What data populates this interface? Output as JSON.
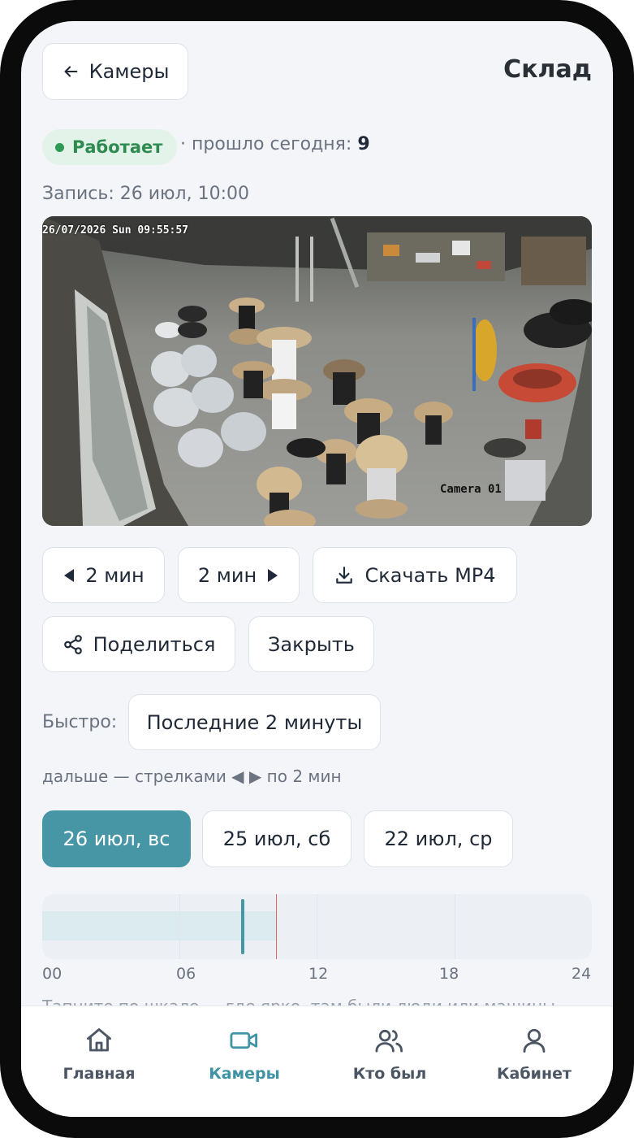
{
  "header": {
    "back_label": "Камеры",
    "title": "Склад"
  },
  "status": {
    "label": "Работает",
    "passed_label": "· прошло сегодня:",
    "passed_count": "9",
    "color": "#2e9a57"
  },
  "recording": {
    "label": "Запись: 26 июл, 10:00"
  },
  "video": {
    "timestamp": "26/07/2026 Sun 09:55:57",
    "camera_name": "Camera 01"
  },
  "controls": {
    "prev_label": "2 мин",
    "next_label": "2 мин",
    "download_label": "Скачать MP4",
    "share_label": "Поделиться",
    "close_label": "Закрыть"
  },
  "quick": {
    "label": "Быстро:",
    "option_label": "Последние 2 минуты",
    "hint": "дальше — стрелками ◀ ▶ по 2 мин"
  },
  "dates": [
    {
      "label": "26 июл, вс",
      "active": true
    },
    {
      "label": "25 июл, сб",
      "active": false
    },
    {
      "label": "22 июл, ср",
      "active": false
    }
  ],
  "timeline": {
    "ticks": [
      "00",
      "06",
      "12",
      "18",
      "24"
    ],
    "recorded_until_hour": 10.25,
    "cursor_hour": 8.75,
    "now_hour": 10.2,
    "accent": "#4796a6",
    "now_color": "#e06a5b"
  },
  "partial_text": "Тапните по шкале — где ярко, там были люди или машины",
  "tabbar": {
    "items": [
      {
        "label": "Главная",
        "icon": "home-icon",
        "active": false
      },
      {
        "label": "Камеры",
        "icon": "video-camera-icon",
        "active": true
      },
      {
        "label": "Кто был",
        "icon": "users-icon",
        "active": false
      },
      {
        "label": "Кабинет",
        "icon": "user-icon",
        "active": false
      }
    ]
  }
}
